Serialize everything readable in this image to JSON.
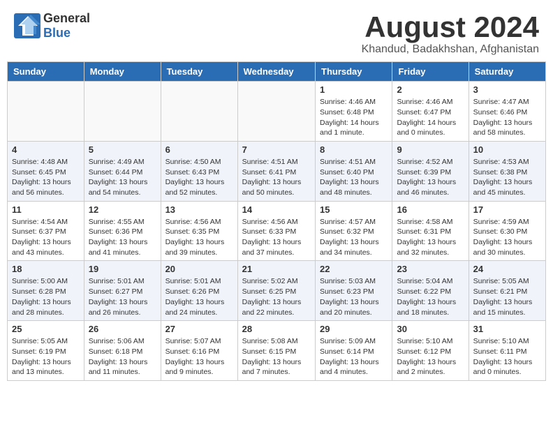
{
  "header": {
    "logo_general": "General",
    "logo_blue": "Blue",
    "title": "August 2024",
    "location": "Khandud, Badakhshan, Afghanistan"
  },
  "weekdays": [
    "Sunday",
    "Monday",
    "Tuesday",
    "Wednesday",
    "Thursday",
    "Friday",
    "Saturday"
  ],
  "weeks": [
    [
      {
        "day": "",
        "info": ""
      },
      {
        "day": "",
        "info": ""
      },
      {
        "day": "",
        "info": ""
      },
      {
        "day": "",
        "info": ""
      },
      {
        "day": "1",
        "info": "Sunrise: 4:46 AM\nSunset: 6:48 PM\nDaylight: 14 hours\nand 1 minute."
      },
      {
        "day": "2",
        "info": "Sunrise: 4:46 AM\nSunset: 6:47 PM\nDaylight: 14 hours\nand 0 minutes."
      },
      {
        "day": "3",
        "info": "Sunrise: 4:47 AM\nSunset: 6:46 PM\nDaylight: 13 hours\nand 58 minutes."
      }
    ],
    [
      {
        "day": "4",
        "info": "Sunrise: 4:48 AM\nSunset: 6:45 PM\nDaylight: 13 hours\nand 56 minutes."
      },
      {
        "day": "5",
        "info": "Sunrise: 4:49 AM\nSunset: 6:44 PM\nDaylight: 13 hours\nand 54 minutes."
      },
      {
        "day": "6",
        "info": "Sunrise: 4:50 AM\nSunset: 6:43 PM\nDaylight: 13 hours\nand 52 minutes."
      },
      {
        "day": "7",
        "info": "Sunrise: 4:51 AM\nSunset: 6:41 PM\nDaylight: 13 hours\nand 50 minutes."
      },
      {
        "day": "8",
        "info": "Sunrise: 4:51 AM\nSunset: 6:40 PM\nDaylight: 13 hours\nand 48 minutes."
      },
      {
        "day": "9",
        "info": "Sunrise: 4:52 AM\nSunset: 6:39 PM\nDaylight: 13 hours\nand 46 minutes."
      },
      {
        "day": "10",
        "info": "Sunrise: 4:53 AM\nSunset: 6:38 PM\nDaylight: 13 hours\nand 45 minutes."
      }
    ],
    [
      {
        "day": "11",
        "info": "Sunrise: 4:54 AM\nSunset: 6:37 PM\nDaylight: 13 hours\nand 43 minutes."
      },
      {
        "day": "12",
        "info": "Sunrise: 4:55 AM\nSunset: 6:36 PM\nDaylight: 13 hours\nand 41 minutes."
      },
      {
        "day": "13",
        "info": "Sunrise: 4:56 AM\nSunset: 6:35 PM\nDaylight: 13 hours\nand 39 minutes."
      },
      {
        "day": "14",
        "info": "Sunrise: 4:56 AM\nSunset: 6:33 PM\nDaylight: 13 hours\nand 37 minutes."
      },
      {
        "day": "15",
        "info": "Sunrise: 4:57 AM\nSunset: 6:32 PM\nDaylight: 13 hours\nand 34 minutes."
      },
      {
        "day": "16",
        "info": "Sunrise: 4:58 AM\nSunset: 6:31 PM\nDaylight: 13 hours\nand 32 minutes."
      },
      {
        "day": "17",
        "info": "Sunrise: 4:59 AM\nSunset: 6:30 PM\nDaylight: 13 hours\nand 30 minutes."
      }
    ],
    [
      {
        "day": "18",
        "info": "Sunrise: 5:00 AM\nSunset: 6:28 PM\nDaylight: 13 hours\nand 28 minutes."
      },
      {
        "day": "19",
        "info": "Sunrise: 5:01 AM\nSunset: 6:27 PM\nDaylight: 13 hours\nand 26 minutes."
      },
      {
        "day": "20",
        "info": "Sunrise: 5:01 AM\nSunset: 6:26 PM\nDaylight: 13 hours\nand 24 minutes."
      },
      {
        "day": "21",
        "info": "Sunrise: 5:02 AM\nSunset: 6:25 PM\nDaylight: 13 hours\nand 22 minutes."
      },
      {
        "day": "22",
        "info": "Sunrise: 5:03 AM\nSunset: 6:23 PM\nDaylight: 13 hours\nand 20 minutes."
      },
      {
        "day": "23",
        "info": "Sunrise: 5:04 AM\nSunset: 6:22 PM\nDaylight: 13 hours\nand 18 minutes."
      },
      {
        "day": "24",
        "info": "Sunrise: 5:05 AM\nSunset: 6:21 PM\nDaylight: 13 hours\nand 15 minutes."
      }
    ],
    [
      {
        "day": "25",
        "info": "Sunrise: 5:05 AM\nSunset: 6:19 PM\nDaylight: 13 hours\nand 13 minutes."
      },
      {
        "day": "26",
        "info": "Sunrise: 5:06 AM\nSunset: 6:18 PM\nDaylight: 13 hours\nand 11 minutes."
      },
      {
        "day": "27",
        "info": "Sunrise: 5:07 AM\nSunset: 6:16 PM\nDaylight: 13 hours\nand 9 minutes."
      },
      {
        "day": "28",
        "info": "Sunrise: 5:08 AM\nSunset: 6:15 PM\nDaylight: 13 hours\nand 7 minutes."
      },
      {
        "day": "29",
        "info": "Sunrise: 5:09 AM\nSunset: 6:14 PM\nDaylight: 13 hours\nand 4 minutes."
      },
      {
        "day": "30",
        "info": "Sunrise: 5:10 AM\nSunset: 6:12 PM\nDaylight: 13 hours\nand 2 minutes."
      },
      {
        "day": "31",
        "info": "Sunrise: 5:10 AM\nSunset: 6:11 PM\nDaylight: 13 hours\nand 0 minutes."
      }
    ]
  ]
}
